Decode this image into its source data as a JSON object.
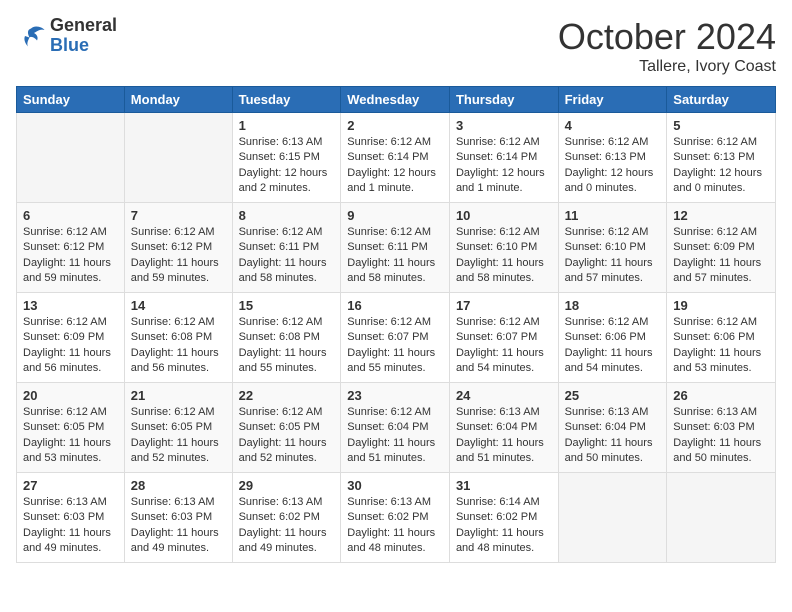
{
  "logo": {
    "general": "General",
    "blue": "Blue"
  },
  "title": "October 2024",
  "location": "Tallere, Ivory Coast",
  "days_header": [
    "Sunday",
    "Monday",
    "Tuesday",
    "Wednesday",
    "Thursday",
    "Friday",
    "Saturday"
  ],
  "weeks": [
    [
      {
        "day": "",
        "info": ""
      },
      {
        "day": "",
        "info": ""
      },
      {
        "day": "1",
        "info": "Sunrise: 6:13 AM\nSunset: 6:15 PM\nDaylight: 12 hours\nand 2 minutes."
      },
      {
        "day": "2",
        "info": "Sunrise: 6:12 AM\nSunset: 6:14 PM\nDaylight: 12 hours\nand 1 minute."
      },
      {
        "day": "3",
        "info": "Sunrise: 6:12 AM\nSunset: 6:14 PM\nDaylight: 12 hours\nand 1 minute."
      },
      {
        "day": "4",
        "info": "Sunrise: 6:12 AM\nSunset: 6:13 PM\nDaylight: 12 hours\nand 0 minutes."
      },
      {
        "day": "5",
        "info": "Sunrise: 6:12 AM\nSunset: 6:13 PM\nDaylight: 12 hours\nand 0 minutes."
      }
    ],
    [
      {
        "day": "6",
        "info": "Sunrise: 6:12 AM\nSunset: 6:12 PM\nDaylight: 11 hours\nand 59 minutes."
      },
      {
        "day": "7",
        "info": "Sunrise: 6:12 AM\nSunset: 6:12 PM\nDaylight: 11 hours\nand 59 minutes."
      },
      {
        "day": "8",
        "info": "Sunrise: 6:12 AM\nSunset: 6:11 PM\nDaylight: 11 hours\nand 58 minutes."
      },
      {
        "day": "9",
        "info": "Sunrise: 6:12 AM\nSunset: 6:11 PM\nDaylight: 11 hours\nand 58 minutes."
      },
      {
        "day": "10",
        "info": "Sunrise: 6:12 AM\nSunset: 6:10 PM\nDaylight: 11 hours\nand 58 minutes."
      },
      {
        "day": "11",
        "info": "Sunrise: 6:12 AM\nSunset: 6:10 PM\nDaylight: 11 hours\nand 57 minutes."
      },
      {
        "day": "12",
        "info": "Sunrise: 6:12 AM\nSunset: 6:09 PM\nDaylight: 11 hours\nand 57 minutes."
      }
    ],
    [
      {
        "day": "13",
        "info": "Sunrise: 6:12 AM\nSunset: 6:09 PM\nDaylight: 11 hours\nand 56 minutes."
      },
      {
        "day": "14",
        "info": "Sunrise: 6:12 AM\nSunset: 6:08 PM\nDaylight: 11 hours\nand 56 minutes."
      },
      {
        "day": "15",
        "info": "Sunrise: 6:12 AM\nSunset: 6:08 PM\nDaylight: 11 hours\nand 55 minutes."
      },
      {
        "day": "16",
        "info": "Sunrise: 6:12 AM\nSunset: 6:07 PM\nDaylight: 11 hours\nand 55 minutes."
      },
      {
        "day": "17",
        "info": "Sunrise: 6:12 AM\nSunset: 6:07 PM\nDaylight: 11 hours\nand 54 minutes."
      },
      {
        "day": "18",
        "info": "Sunrise: 6:12 AM\nSunset: 6:06 PM\nDaylight: 11 hours\nand 54 minutes."
      },
      {
        "day": "19",
        "info": "Sunrise: 6:12 AM\nSunset: 6:06 PM\nDaylight: 11 hours\nand 53 minutes."
      }
    ],
    [
      {
        "day": "20",
        "info": "Sunrise: 6:12 AM\nSunset: 6:05 PM\nDaylight: 11 hours\nand 53 minutes."
      },
      {
        "day": "21",
        "info": "Sunrise: 6:12 AM\nSunset: 6:05 PM\nDaylight: 11 hours\nand 52 minutes."
      },
      {
        "day": "22",
        "info": "Sunrise: 6:12 AM\nSunset: 6:05 PM\nDaylight: 11 hours\nand 52 minutes."
      },
      {
        "day": "23",
        "info": "Sunrise: 6:12 AM\nSunset: 6:04 PM\nDaylight: 11 hours\nand 51 minutes."
      },
      {
        "day": "24",
        "info": "Sunrise: 6:13 AM\nSunset: 6:04 PM\nDaylight: 11 hours\nand 51 minutes."
      },
      {
        "day": "25",
        "info": "Sunrise: 6:13 AM\nSunset: 6:04 PM\nDaylight: 11 hours\nand 50 minutes."
      },
      {
        "day": "26",
        "info": "Sunrise: 6:13 AM\nSunset: 6:03 PM\nDaylight: 11 hours\nand 50 minutes."
      }
    ],
    [
      {
        "day": "27",
        "info": "Sunrise: 6:13 AM\nSunset: 6:03 PM\nDaylight: 11 hours\nand 49 minutes."
      },
      {
        "day": "28",
        "info": "Sunrise: 6:13 AM\nSunset: 6:03 PM\nDaylight: 11 hours\nand 49 minutes."
      },
      {
        "day": "29",
        "info": "Sunrise: 6:13 AM\nSunset: 6:02 PM\nDaylight: 11 hours\nand 49 minutes."
      },
      {
        "day": "30",
        "info": "Sunrise: 6:13 AM\nSunset: 6:02 PM\nDaylight: 11 hours\nand 48 minutes."
      },
      {
        "day": "31",
        "info": "Sunrise: 6:14 AM\nSunset: 6:02 PM\nDaylight: 11 hours\nand 48 minutes."
      },
      {
        "day": "",
        "info": ""
      },
      {
        "day": "",
        "info": ""
      }
    ]
  ]
}
